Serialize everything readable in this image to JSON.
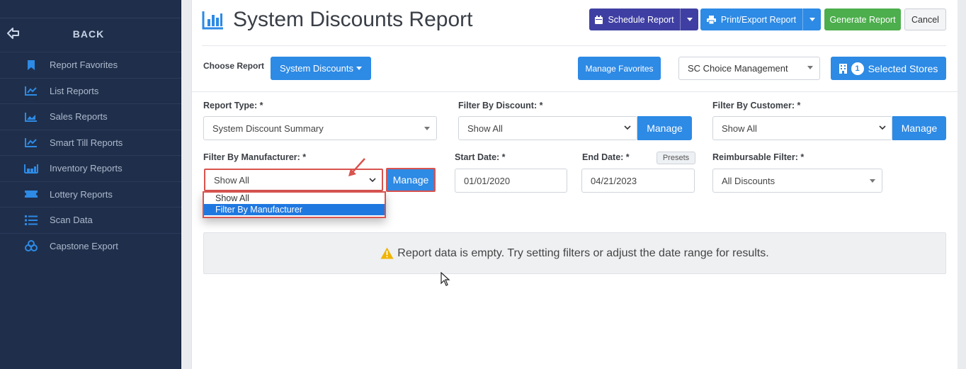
{
  "sidebar": {
    "back_label": "BACK",
    "items": [
      {
        "label": "Report Favorites",
        "icon": "bookmark-icon"
      },
      {
        "label": "List Reports",
        "icon": "line-chart-icon"
      },
      {
        "label": "Sales Reports",
        "icon": "area-chart-icon"
      },
      {
        "label": "Smart Till Reports",
        "icon": "line-chart-icon"
      },
      {
        "label": "Inventory Reports",
        "icon": "warehouse-icon"
      },
      {
        "label": "Lottery Reports",
        "icon": "ticket-icon"
      },
      {
        "label": "Scan Data",
        "icon": "list-icon"
      },
      {
        "label": "Capstone Export",
        "icon": "cubes-icon"
      }
    ]
  },
  "header": {
    "title": "System Discounts Report",
    "schedule_label": "Schedule Report",
    "print_label": "Print/Export Report",
    "generate_label": "Generate Report",
    "cancel_label": "Cancel"
  },
  "toolbar": {
    "choose_label": "Choose Report",
    "report_button": "System Discounts",
    "manage_favorites": "Manage Favorites",
    "store_select": "SC Choice Management",
    "selected_count": "1",
    "selected_label": "Selected Stores"
  },
  "filters": {
    "report_type_label": "Report Type: *",
    "report_type_value": "System Discount Summary",
    "discount_label": "Filter By Discount: *",
    "discount_value": "Show All",
    "customer_label": "Filter By Customer: *",
    "customer_value": "Show All",
    "manage_label": "Manage",
    "manufacturer_label": "Filter By Manufacturer: *",
    "manufacturer_value": "Show All",
    "manufacturer_options": [
      "Show All",
      "Filter By Manufacturer"
    ],
    "start_label": "Start Date: *",
    "start_value": "01/01/2020",
    "end_label": "End Date: *",
    "end_value": "04/21/2023",
    "presets_label": "Presets",
    "reimbursable_label": "Reimbursable Filter: *",
    "reimbursable_value": "All Discounts"
  },
  "message": {
    "empty_text": "Report data is empty. Try setting filters or adjust the date range for results."
  },
  "colors": {
    "sidebar_bg": "#1f2f4b",
    "primary": "#2d8ae5",
    "schedule": "#3f3fa3",
    "generate": "#4cae4c",
    "highlight": "#d9534f",
    "warning": "#f0b400"
  }
}
